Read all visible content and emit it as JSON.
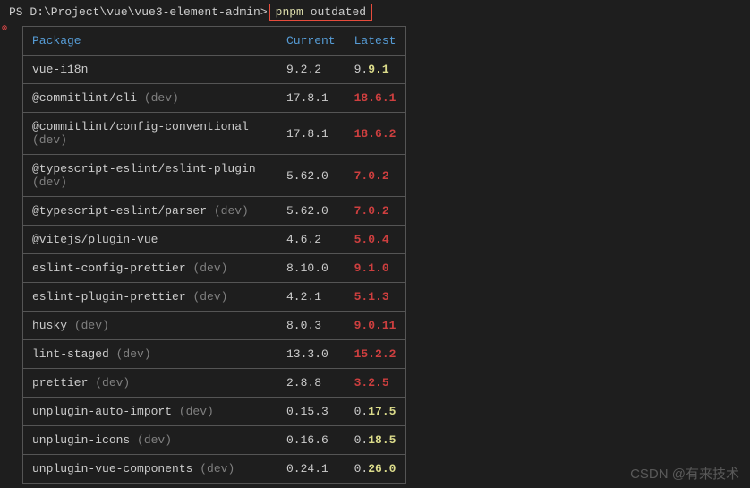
{
  "prompt": {
    "prefix": "PS D:\\Project\\vue\\vue3-element-admin>",
    "command_part1": "pnpm",
    "command_part2": "outdated"
  },
  "headers": {
    "package": "Package",
    "current": "Current",
    "latest": "Latest"
  },
  "rows": [
    {
      "name": "vue-i18n",
      "dev": "",
      "current": "9.2.2",
      "latest_prefix": "9.",
      "latest_highlight": "9.1",
      "latest_style": "yellow"
    },
    {
      "name": "@commitlint/cli",
      "dev": " (dev)",
      "current": "17.8.1",
      "latest_prefix": "",
      "latest_highlight": "18.6.1",
      "latest_style": "red"
    },
    {
      "name": "@commitlint/config-conventional",
      "dev": " (dev)",
      "current": "17.8.1",
      "latest_prefix": "",
      "latest_highlight": "18.6.2",
      "latest_style": "red"
    },
    {
      "name": "@typescript-eslint/eslint-plugin",
      "dev": " (dev)",
      "current": "5.62.0",
      "latest_prefix": "",
      "latest_highlight": "7.0.2",
      "latest_style": "red"
    },
    {
      "name": "@typescript-eslint/parser",
      "dev": " (dev)",
      "current": "5.62.0",
      "latest_prefix": "",
      "latest_highlight": "7.0.2",
      "latest_style": "red"
    },
    {
      "name": "@vitejs/plugin-vue",
      "dev": "",
      "current": "4.6.2",
      "latest_prefix": "",
      "latest_highlight": "5.0.4",
      "latest_style": "red"
    },
    {
      "name": "eslint-config-prettier",
      "dev": " (dev)",
      "current": "8.10.0",
      "latest_prefix": "",
      "latest_highlight": "9.1.0",
      "latest_style": "red"
    },
    {
      "name": "eslint-plugin-prettier",
      "dev": " (dev)",
      "current": "4.2.1",
      "latest_prefix": "",
      "latest_highlight": "5.1.3",
      "latest_style": "red"
    },
    {
      "name": "husky",
      "dev": " (dev)",
      "current": "8.0.3",
      "latest_prefix": "",
      "latest_highlight": "9.0.11",
      "latest_style": "red"
    },
    {
      "name": "lint-staged",
      "dev": " (dev)",
      "current": "13.3.0",
      "latest_prefix": "",
      "latest_highlight": "15.2.2",
      "latest_style": "red"
    },
    {
      "name": "prettier",
      "dev": " (dev)",
      "current": "2.8.8",
      "latest_prefix": "",
      "latest_highlight": "3.2.5",
      "latest_style": "red"
    },
    {
      "name": "unplugin-auto-import",
      "dev": " (dev)",
      "current": "0.15.3",
      "latest_prefix": "0.",
      "latest_highlight": "17.5",
      "latest_style": "yellow"
    },
    {
      "name": "unplugin-icons",
      "dev": " (dev)",
      "current": "0.16.6",
      "latest_prefix": "0.",
      "latest_highlight": "18.5",
      "latest_style": "yellow"
    },
    {
      "name": "unplugin-vue-components",
      "dev": " (dev)",
      "current": "0.24.1",
      "latest_prefix": "0.",
      "latest_highlight": "26.0",
      "latest_style": "yellow"
    }
  ],
  "watermark": "CSDN @有来技术"
}
